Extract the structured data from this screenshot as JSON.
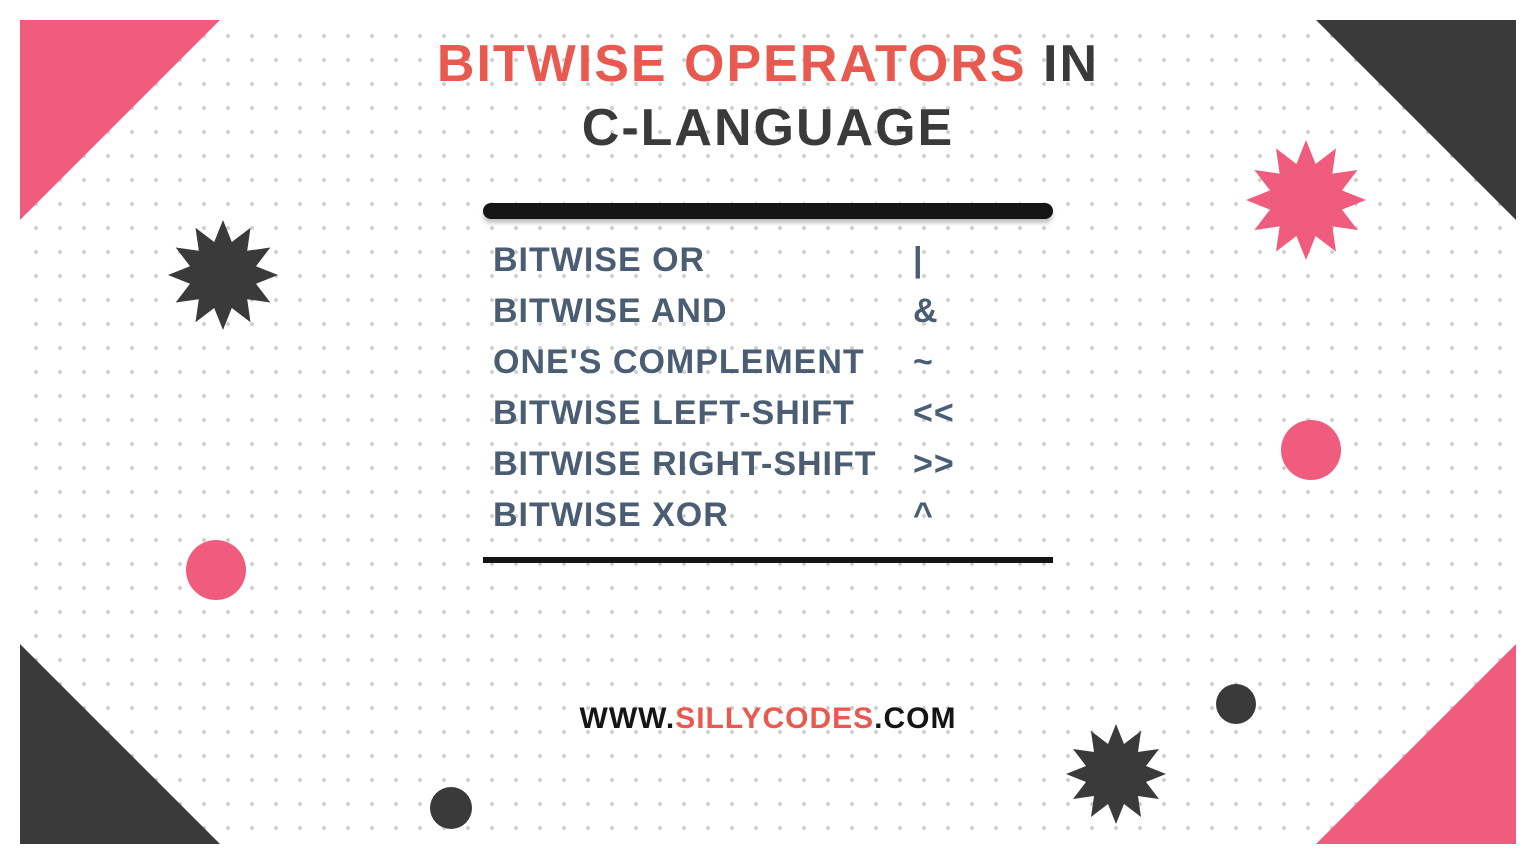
{
  "title": {
    "accent": "BITWISE OPERATORS",
    "rest": " IN",
    "line2": "C-LANGUAGE"
  },
  "rows": [
    {
      "name": "BITWISE OR",
      "sym": "|"
    },
    {
      "name": "BITWISE AND",
      "sym": "&"
    },
    {
      "name": "ONE'S COMPLEMENT",
      "sym": "~"
    },
    {
      "name": "BITWISE LEFT-SHIFT",
      "sym": "<<"
    },
    {
      "name": "BITWISE RIGHT-SHIFT",
      "sym": ">>"
    },
    {
      "name": "BITWISE XOR",
      "sym": "^"
    }
  ],
  "footer": {
    "pre": "WWW.",
    "mid": "SILLYCODES",
    "post": ".COM"
  },
  "colors": {
    "pink": "#f05c7e",
    "dark": "#3a3a3a",
    "accent": "#e85a4f",
    "text": "#4a5d73"
  }
}
